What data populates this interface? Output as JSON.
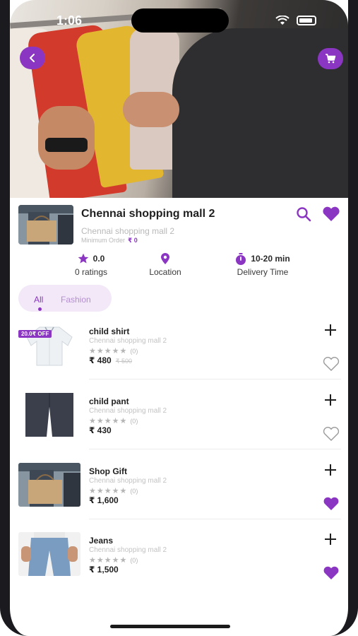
{
  "status_bar": {
    "time": "1:06"
  },
  "colors": {
    "accent": "#8b36c2",
    "accent_light": "#f2e8f8"
  },
  "hero": {
    "back_icon": "chevron-left-icon",
    "cart_icon": "cart-icon"
  },
  "store": {
    "title": "Chennai shopping mall 2",
    "subtitle": "Chennai shopping mall 2",
    "min_order_label": "Minimum Order",
    "min_order_value": "₹ 0"
  },
  "stats": {
    "rating_value": "0.0",
    "rating_label": "0 ratings",
    "location_label": "Location",
    "delivery_value": "10-20 min",
    "delivery_label": "Delivery Time"
  },
  "tabs": [
    {
      "label": "All",
      "active": true
    },
    {
      "label": "Fashion",
      "active": false
    }
  ],
  "products": [
    {
      "name": "child shirt",
      "store": "Chennai shopping mall 2",
      "stars": "★★★★★",
      "rating_count": "(0)",
      "price": "₹ 480",
      "old_price": "₹ 500",
      "badge": "20.0₹ OFF",
      "favorite": false
    },
    {
      "name": "child pant",
      "store": "Chennai shopping mall 2",
      "stars": "★★★★★",
      "rating_count": "(0)",
      "price": "₹ 430",
      "old_price": "",
      "badge": "",
      "favorite": false
    },
    {
      "name": "Shop Gift",
      "store": "Chennai shopping mall 2",
      "stars": "★★★★★",
      "rating_count": "(0)",
      "price": "₹ 1,600",
      "old_price": "",
      "badge": "",
      "favorite": true
    },
    {
      "name": "Jeans",
      "store": "Chennai shopping mall 2",
      "stars": "★★★★★",
      "rating_count": "(0)",
      "price": "₹ 1,500",
      "old_price": "",
      "badge": "",
      "favorite": true
    }
  ]
}
